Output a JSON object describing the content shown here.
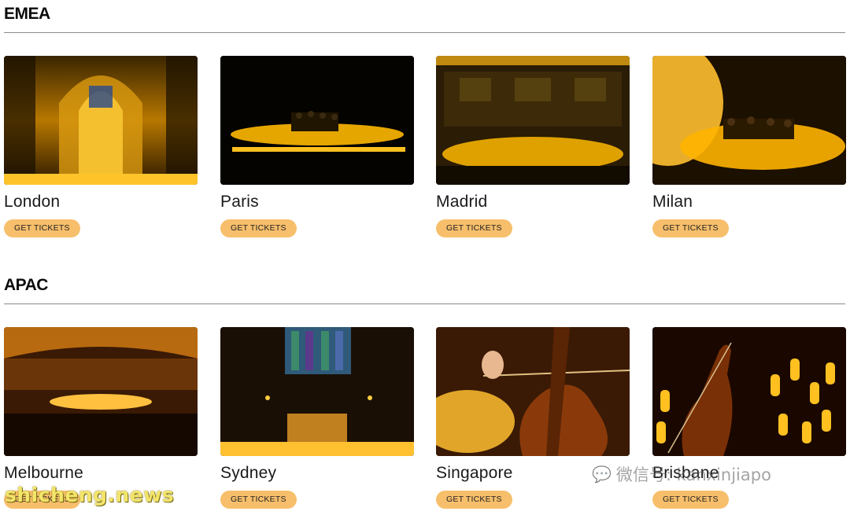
{
  "sections": [
    {
      "title": "EMEA",
      "cards": [
        {
          "city": "London",
          "button": "GET TICKETS",
          "image": "cathedral-candlelight-photo"
        },
        {
          "city": "Paris",
          "button": "GET TICKETS",
          "image": "stage-quartet-photo"
        },
        {
          "city": "Madrid",
          "button": "GET TICKETS",
          "image": "hall-candlelight-photo"
        },
        {
          "city": "Milan",
          "button": "GET TICKETS",
          "image": "quartet-candles-photo"
        }
      ]
    },
    {
      "title": "APAC",
      "cards": [
        {
          "city": "Melbourne",
          "button": "GET TICKETS",
          "image": "theatre-candlelight-photo"
        },
        {
          "city": "Sydney",
          "button": "GET TICKETS",
          "image": "church-altar-photo"
        },
        {
          "city": "Singapore",
          "button": "GET TICKETS",
          "image": "cello-closeup-photo"
        },
        {
          "city": "Brisbane",
          "button": "GET TICKETS",
          "image": "violin-candles-photo"
        }
      ]
    }
  ],
  "watermarks": {
    "left": "shicheng.news",
    "right": "微信号: kanxinjiapo"
  },
  "colors": {
    "button": "#f7bf6b",
    "candle": "#ffb400"
  }
}
